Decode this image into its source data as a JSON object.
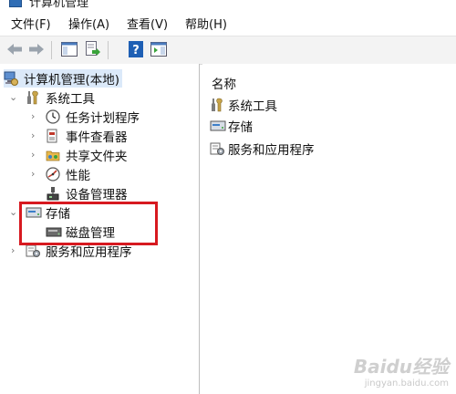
{
  "window": {
    "title": "计算机管理"
  },
  "menubar": {
    "items": [
      {
        "label": "文件(F)"
      },
      {
        "label": "操作(A)"
      },
      {
        "label": "查看(V)"
      },
      {
        "label": "帮助(H)"
      }
    ]
  },
  "toolbar": {
    "buttons": [
      {
        "icon": "back-arrow-icon"
      },
      {
        "icon": "forward-arrow-icon"
      },
      {
        "icon": "show-hide-console-tree-icon"
      },
      {
        "icon": "export-list-icon"
      },
      {
        "icon": "help-icon"
      },
      {
        "icon": "action-pane-icon"
      }
    ]
  },
  "tree": {
    "root": "计算机管理(本地)",
    "items": [
      {
        "label": "系统工具",
        "icon": "tools-icon",
        "expanded": true
      },
      {
        "label": "任务计划程序",
        "icon": "clock-icon"
      },
      {
        "label": "事件查看器",
        "icon": "event-viewer-icon"
      },
      {
        "label": "共享文件夹",
        "icon": "shared-folder-icon"
      },
      {
        "label": "性能",
        "icon": "performance-icon"
      },
      {
        "label": "设备管理器",
        "icon": "device-manager-icon"
      },
      {
        "label": "存储",
        "icon": "storage-icon",
        "expanded": true
      },
      {
        "label": "磁盘管理",
        "icon": "disk-icon"
      },
      {
        "label": "服务和应用程序",
        "icon": "services-icon"
      }
    ]
  },
  "list": {
    "header": "名称",
    "items": [
      {
        "label": "系统工具",
        "icon": "tools-icon"
      },
      {
        "label": "存储",
        "icon": "storage-icon"
      },
      {
        "label": "服务和应用程序",
        "icon": "services-icon"
      }
    ]
  },
  "watermark": {
    "main": "Baidu经验",
    "sub": "jingyan.baidu.com"
  },
  "colors": {
    "highlight": "#d71920",
    "selected_root": "#dbe9f9"
  }
}
